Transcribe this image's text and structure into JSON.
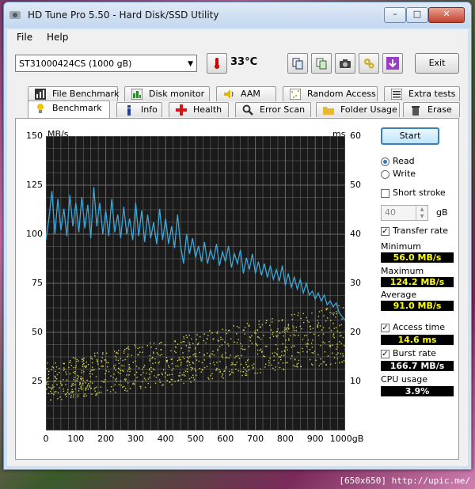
{
  "window": {
    "title": "HD Tune Pro 5.50 - Hard Disk/SSD Utility"
  },
  "menu": {
    "file": "File",
    "help": "Help"
  },
  "toolbar": {
    "drive": "ST31000424CS (1000 gB)",
    "temperature": "33°C",
    "exit": "Exit"
  },
  "tabs_row1": [
    "File Benchmark",
    "Disk monitor",
    "AAM",
    "Random Access",
    "Extra tests"
  ],
  "tabs_row2": [
    "Benchmark",
    "Info",
    "Health",
    "Error Scan",
    "Folder Usage",
    "Erase"
  ],
  "controls": {
    "start": "Start",
    "read": "Read",
    "write": "Write",
    "short_stroke": "Short stroke",
    "stroke_value": "40",
    "stroke_unit": "gB",
    "transfer_rate": "Transfer rate",
    "minimum_label": "Minimum",
    "minimum": "56.0 MB/s",
    "maximum_label": "Maximum",
    "maximum": "124.2 MB/s",
    "average_label": "Average",
    "average": "91.0 MB/s",
    "access_time": "Access time",
    "access_value": "14.6 ms",
    "burst_rate": "Burst rate",
    "burst_value": "166.7 MB/s",
    "cpu_label": "CPU usage",
    "cpu_value": "3.9%"
  },
  "footer": "[650x650] http://upic.me/",
  "chart_data": {
    "type": "line",
    "ylabel_left": "MB/s",
    "ylabel_right": "ms",
    "y_left_ticks": [
      "150",
      "125",
      "100",
      "75",
      "50",
      "25"
    ],
    "y_right_ticks": [
      "60",
      "50",
      "40",
      "30",
      "20",
      "10"
    ],
    "x_ticks": [
      "0",
      "100",
      "200",
      "300",
      "400",
      "500",
      "600",
      "700",
      "800",
      "900",
      "1000gB"
    ],
    "ylim_left": [
      0,
      150
    ],
    "ylim_right": [
      0,
      60
    ],
    "xlim": [
      0,
      1000
    ],
    "grid": true,
    "colors": {
      "transfer": "#3ba7d9",
      "access": "#d6d24a",
      "background": "#1a1a1a",
      "grid": "#6a6a6a"
    },
    "series": [
      {
        "name": "Transfer rate",
        "x": [
          0,
          10,
          20,
          30,
          40,
          50,
          60,
          70,
          80,
          90,
          100,
          110,
          120,
          130,
          140,
          150,
          160,
          170,
          180,
          190,
          200,
          210,
          220,
          230,
          240,
          250,
          260,
          270,
          280,
          290,
          300,
          310,
          320,
          330,
          340,
          350,
          360,
          370,
          380,
          390,
          400,
          410,
          420,
          430,
          440,
          450,
          460,
          470,
          480,
          490,
          500,
          510,
          520,
          530,
          540,
          550,
          560,
          570,
          580,
          590,
          600,
          610,
          620,
          630,
          640,
          650,
          660,
          670,
          680,
          690,
          700,
          710,
          720,
          730,
          740,
          750,
          760,
          770,
          780,
          790,
          800,
          810,
          820,
          830,
          840,
          850,
          860,
          870,
          880,
          890,
          900,
          910,
          920,
          930,
          940,
          950,
          960,
          970,
          980,
          990,
          1000
        ],
        "values": [
          97,
          108,
          122,
          100,
          118,
          102,
          113,
          99,
          120,
          104,
          116,
          101,
          119,
          103,
          115,
          98,
          124,
          104,
          116,
          100,
          112,
          99,
          118,
          101,
          110,
          98,
          114,
          100,
          108,
          97,
          116,
          99,
          112,
          96,
          110,
          98,
          106,
          95,
          113,
          97,
          108,
          95,
          104,
          93,
          110,
          94,
          85,
          100,
          90,
          98,
          88,
          94,
          86,
          96,
          85,
          92,
          87,
          95,
          84,
          91,
          86,
          94,
          83,
          90,
          85,
          92,
          80,
          88,
          82,
          90,
          80,
          86,
          79,
          85,
          78,
          84,
          77,
          82,
          76,
          84,
          74,
          80,
          73,
          78,
          72,
          77,
          70,
          75,
          69,
          71,
          67,
          70,
          66,
          69,
          64,
          66,
          63,
          65,
          60,
          58,
          56
        ]
      },
      {
        "name": "Access time",
        "x_range": [
          0,
          1000
        ],
        "values_range_ms": [
          6,
          26
        ],
        "average_ms": 14.6
      }
    ]
  }
}
